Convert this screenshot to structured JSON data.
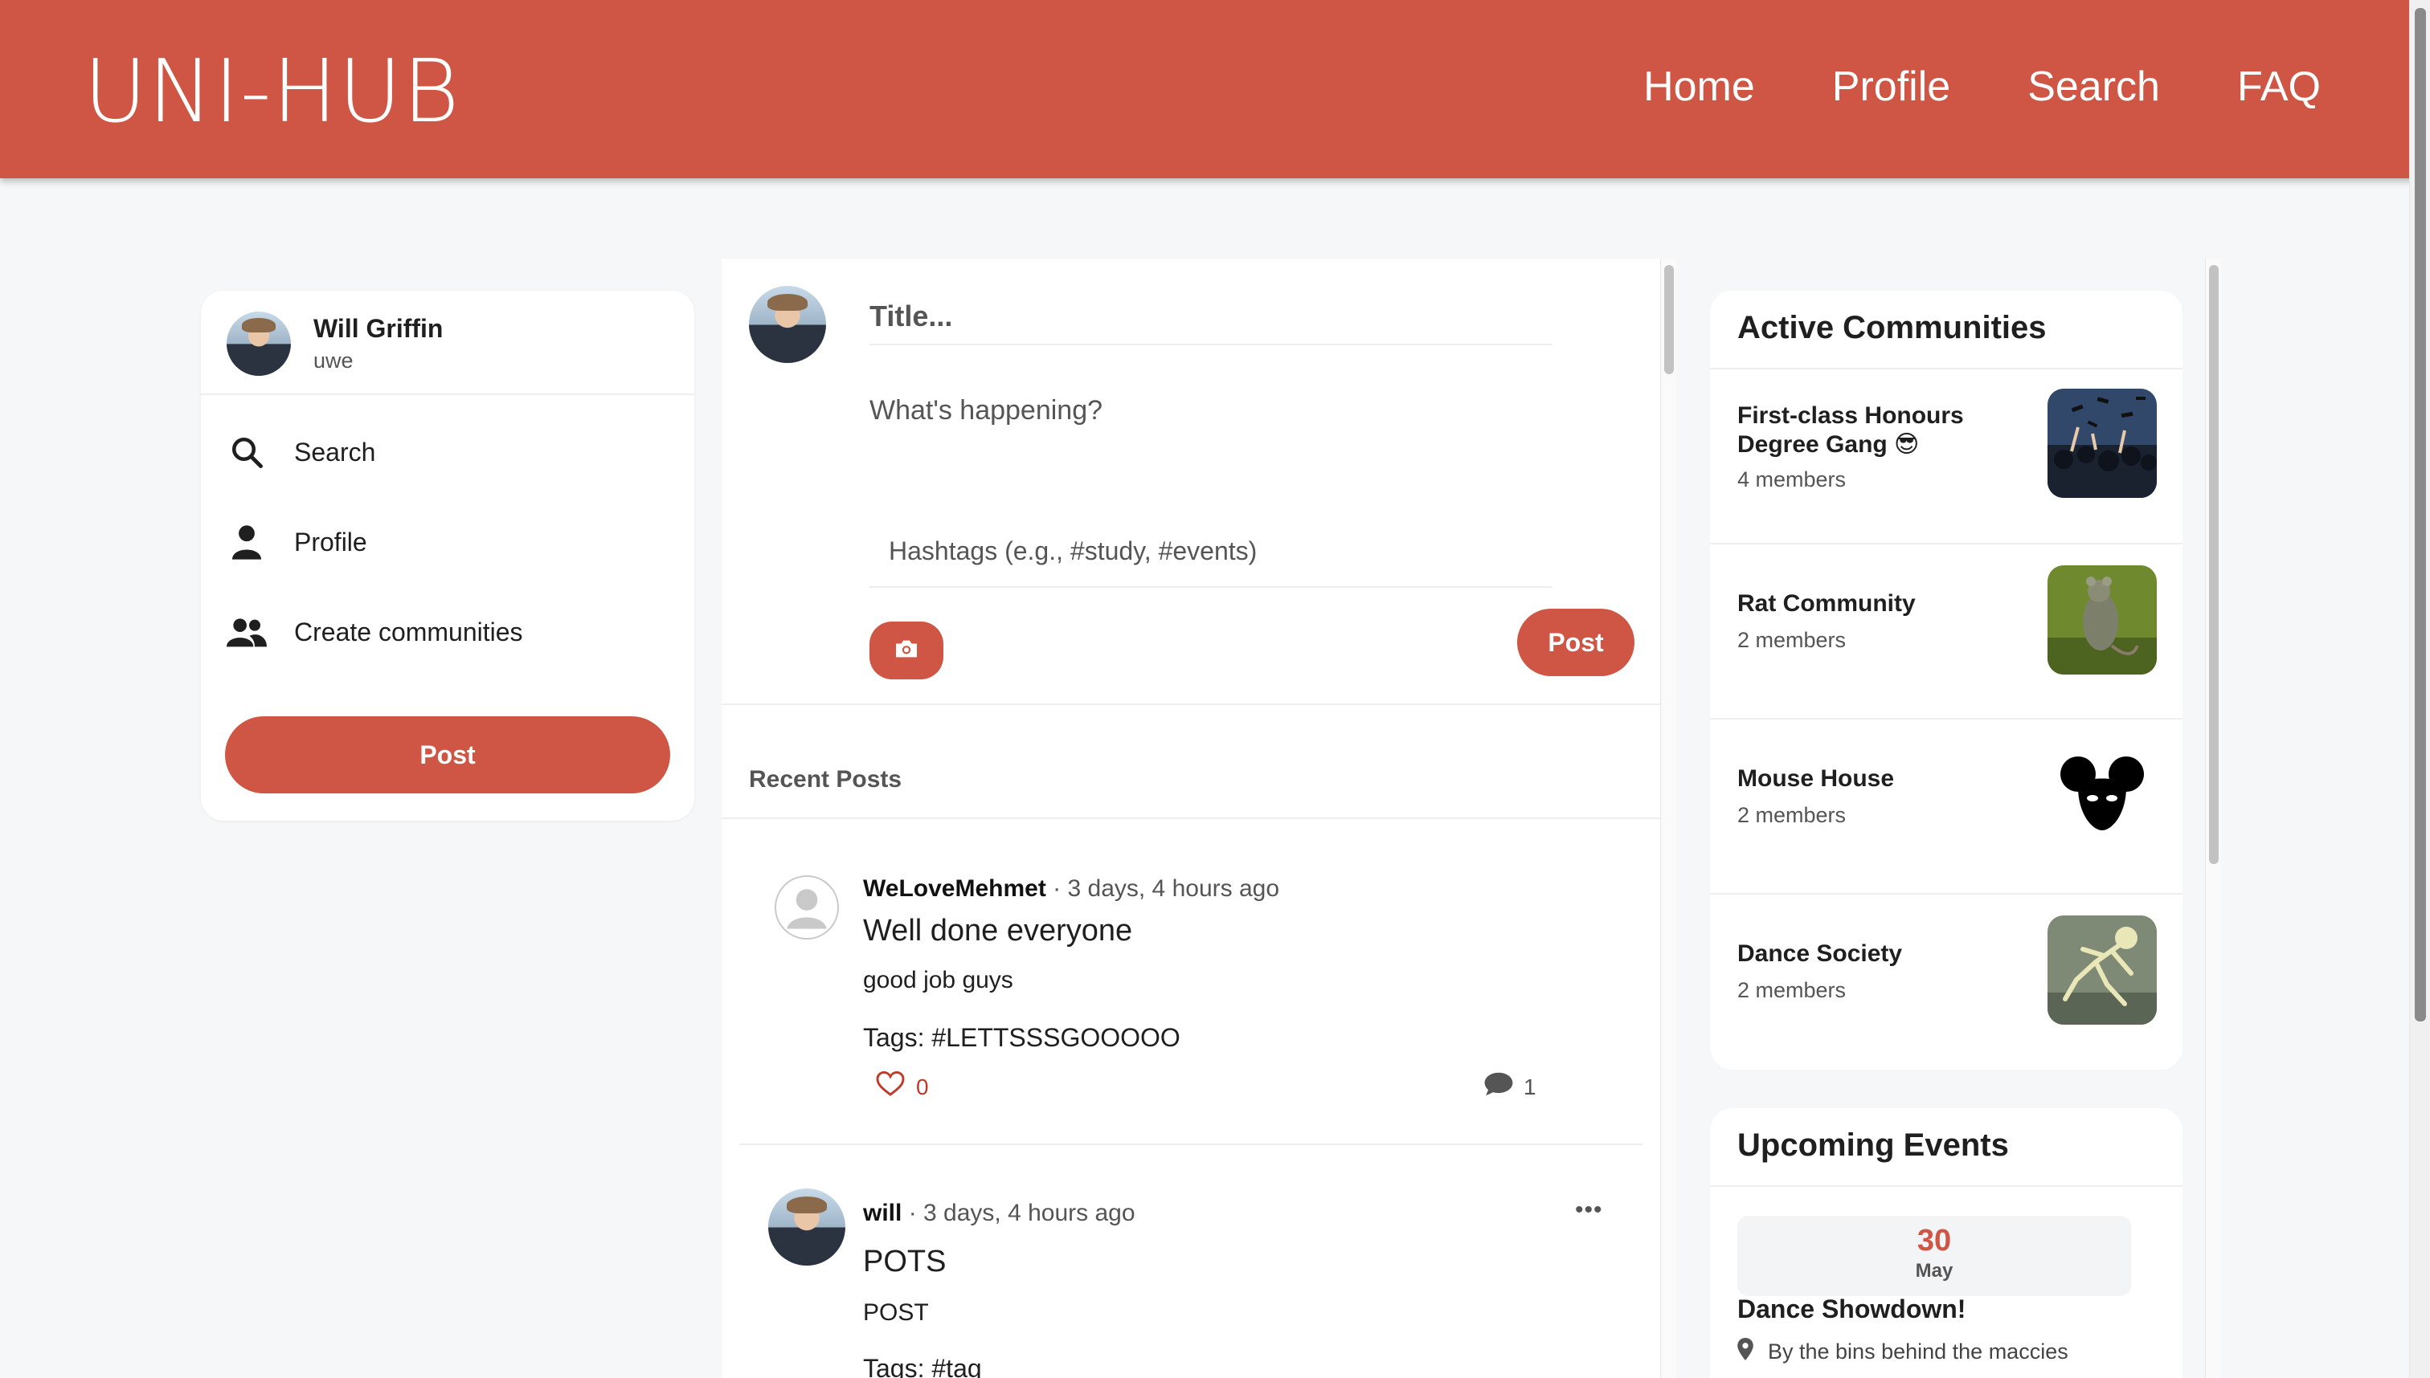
{
  "header": {
    "logo": "UNI-HUB",
    "nav": [
      "Home",
      "Profile",
      "Search",
      "FAQ"
    ]
  },
  "sidebar": {
    "user_name": "Will Griffin",
    "user_sub": "uwe",
    "items": [
      {
        "label": "Search",
        "icon": "search-icon"
      },
      {
        "label": "Profile",
        "icon": "person-icon"
      },
      {
        "label": "Create communities",
        "icon": "users-icon"
      }
    ],
    "post_button": "Post"
  },
  "composer": {
    "title_placeholder": "Title...",
    "body_placeholder": "What's happening?",
    "tags_placeholder": "Hashtags (e.g., #study, #events)",
    "post_button": "Post"
  },
  "feed": {
    "heading": "Recent Posts",
    "posts": [
      {
        "author": "WeLoveMehmet",
        "time": "· 3 days, 4 hours ago",
        "title": "Well done everyone",
        "text": "good job guys",
        "tags": "Tags: #LETTSSSGOOOOO",
        "likes": "0",
        "comments": "1"
      },
      {
        "author": "will",
        "time": "· 3 days, 4 hours ago",
        "title": "POTS",
        "text": "POST",
        "tags": "Tags: #tag",
        "more": "•••"
      }
    ]
  },
  "communities": {
    "title": "Active Communities",
    "items": [
      {
        "name": "First-class Honours Degree Gang 😎",
        "members": "4 members"
      },
      {
        "name": "Rat Community",
        "members": "2 members"
      },
      {
        "name": "Mouse House",
        "members": "2 members"
      },
      {
        "name": "Dance Society",
        "members": "2 members"
      }
    ]
  },
  "events": {
    "title": "Upcoming Events",
    "items": [
      {
        "day": "30",
        "month": "May",
        "name": "Dance Showdown!",
        "location": "By the bins behind the maccies"
      }
    ]
  },
  "colors": {
    "brand": "#cf5644",
    "background": "#f6f7f9"
  }
}
